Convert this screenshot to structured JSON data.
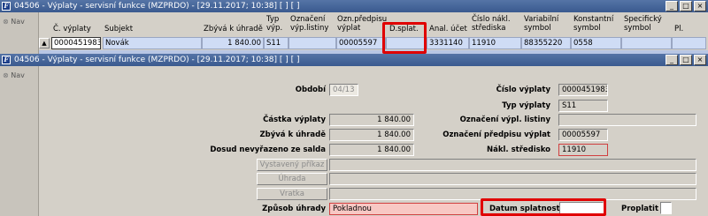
{
  "window1": {
    "title": "04506 - Výplaty - servisní funkce (MZPRDO) - [29.11.2017; 10:38]  [ ]  [ ]",
    "nav_label": "Nav",
    "columns": {
      "c_vyplaty": "Č. výplaty",
      "subjekt": "Subjekt",
      "zbyva": "Zbývá k úhradě",
      "typ": "Typ\nvýp.",
      "oznaceni": "Označení\nvýp.listiny",
      "ozn_predpisu": "Ozn.předpisu\nvýplat",
      "d_splat": "D.splat.",
      "anal": "Anal. účet",
      "cislo_nakl": "Číslo nákl.\nstřediska",
      "variabilni": "Variabilní\nsymbol",
      "konstantni": "Konstantní\nsymbol",
      "specificky": "Specifický\nsymbol",
      "pl": "Pl."
    },
    "row": {
      "c_vyplaty": "0000451983",
      "subjekt": "Novák",
      "zbyva": "1 840.00",
      "typ": "S11",
      "oznaceni": "",
      "ozn_predpisu": "00005597",
      "d_splat": "",
      "anal": "3331140",
      "cislo_nakl": "11910",
      "variabilni": "88355220",
      "konstantni": "0558",
      "specificky": "",
      "pl": ""
    }
  },
  "window2": {
    "title": "04506 - Výplaty - servisní funkce (MZPRDO) - [29.11.2017; 10:38]  [ ]  [ ]",
    "nav_label": "Nav",
    "fields": {
      "obdobi_label": "Období",
      "obdobi_value": "04/13",
      "cislo_vyplaty_label": "Číslo výplaty",
      "cislo_vyplaty_value": "0000451983",
      "typ_vyplaty_label": "Typ výplaty",
      "typ_vyplaty_value": "S11",
      "castka_label": "Částka výplaty",
      "castka_value": "1 840.00",
      "oznaceni_label": "Označení výpl. listiny",
      "oznaceni_value": "",
      "zbyva_label": "Zbývá k úhradě",
      "zbyva_value": "1 840.00",
      "ozn_predpisu_label": "Označení předpisu výplat",
      "ozn_predpisu_value": "00005597",
      "dosud_label": "Dosud nevyřazeno ze salda",
      "dosud_value": "1 840.00",
      "nakl_label": "Nákl. středisko",
      "nakl_value": "11910",
      "zpusob_label": "Způsob úhrady",
      "zpusob_value": "Pokladnou",
      "datum_label": "Datum splatnosti",
      "datum_value": "",
      "proplatit_label": "Proplatit"
    },
    "buttons": {
      "vystaveny": "Vystavený příkaz",
      "uhrada": "Úhrada",
      "vratka": "Vratka"
    }
  },
  "colors": {
    "title_bar": "#3a5a8f",
    "highlight": "#e00000",
    "row_bg": "#cfdcf5",
    "required": "#f8c8c4"
  }
}
